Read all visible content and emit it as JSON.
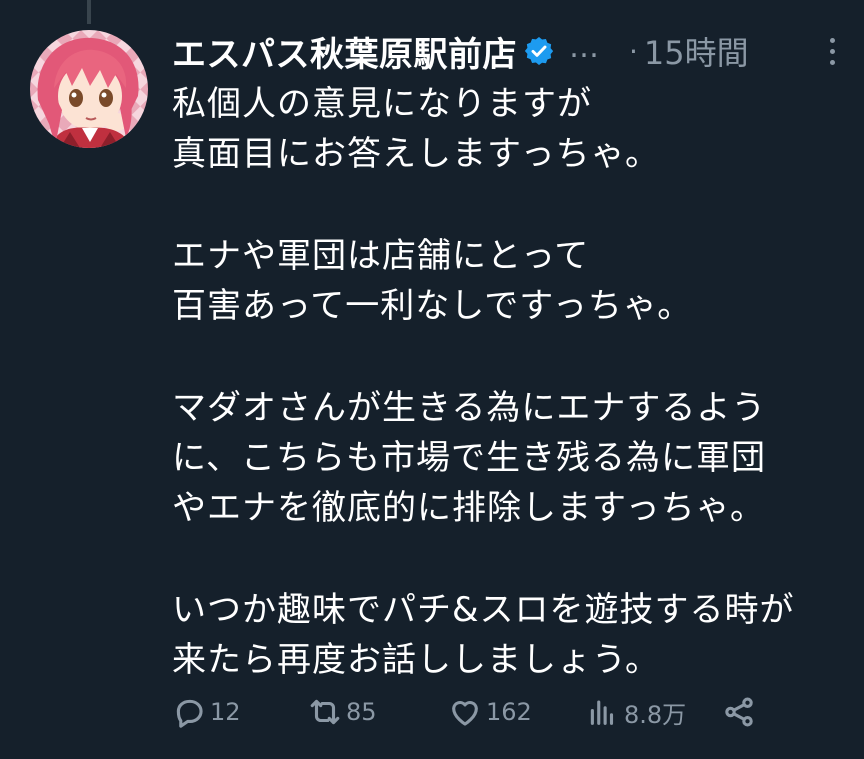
{
  "tweet": {
    "display_name": "エスパス秋葉原駅前店",
    "ellipsis": "…",
    "separator": "·",
    "time": "15時間",
    "paragraphs": [
      [
        "私個人の意見になりますが",
        "真面目にお答えしますっちゃ。"
      ],
      [
        "エナや軍団は店舗にとって",
        "百害あって一利なしですっちゃ。"
      ],
      [
        "マダオさんが生きる為にエナするよう",
        "に、こちらも市場で生き残る為に軍団",
        "やエナを徹底的に排除しますっちゃ。"
      ],
      [
        "いつか趣味でパチ&スロを遊技する時が",
        "来たら再度お話ししましょう。"
      ]
    ],
    "actions": {
      "reply_count": "12",
      "retweet_count": "85",
      "like_count": "162",
      "views_count": "8.8万"
    }
  },
  "colors": {
    "background": "#15202b",
    "text": "#ffffff",
    "muted": "#8b98a5",
    "verified": "#1d9bf0"
  },
  "icons": [
    "verified-badge-icon",
    "more-icon",
    "reply-icon",
    "retweet-icon",
    "like-icon",
    "views-icon",
    "share-icon"
  ]
}
